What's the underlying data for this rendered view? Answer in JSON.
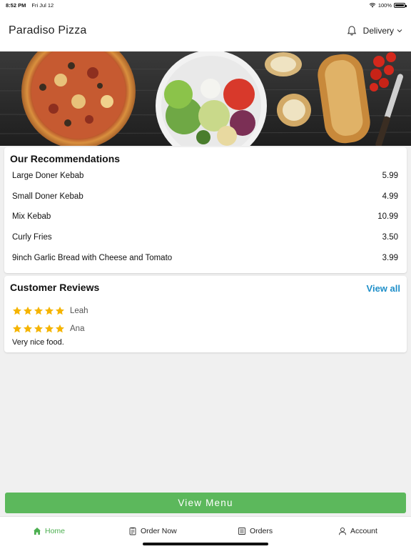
{
  "status_bar": {
    "time": "8:52 PM",
    "date": "Fri Jul 12",
    "battery": "100%",
    "wifi_icon": "wifi-icon",
    "battery_icon": "battery-icon"
  },
  "header": {
    "title": "Paradiso Pizza",
    "notification_icon": "bell-icon",
    "delivery_label": "Delivery",
    "dropdown_icon": "chevron-down-icon"
  },
  "banner": {
    "content": "food-banner-image"
  },
  "recommendations": {
    "heading": "Our Recommendations",
    "items": [
      {
        "name": "Large Doner Kebab",
        "price": "5.99"
      },
      {
        "name": "Small Doner Kebab",
        "price": "4.99"
      },
      {
        "name": "Mix Kebab",
        "price": "10.99"
      },
      {
        "name": "Curly Fries",
        "price": "3.50"
      },
      {
        "name": "9inch Garlic Bread with Cheese and Tomato",
        "price": "3.99"
      }
    ]
  },
  "reviews": {
    "heading": "Customer Reviews",
    "view_all": "View all",
    "items": [
      {
        "name": "Leah",
        "rating": 5,
        "text": ""
      },
      {
        "name": "Ana",
        "rating": 5,
        "text": "Very nice food."
      }
    ]
  },
  "view_menu_label": "View Menu",
  "tabs": [
    {
      "label": "Home",
      "icon": "home-icon",
      "active": true
    },
    {
      "label": "Order Now",
      "icon": "clipboard-icon",
      "active": false
    },
    {
      "label": "Orders",
      "icon": "receipt-icon",
      "active": false
    },
    {
      "label": "Account",
      "icon": "user-icon",
      "active": false
    }
  ],
  "colors": {
    "accent_green": "#5cb85c",
    "tab_active": "#4caf50",
    "link_blue": "#1f8fc9",
    "star": "#f5b400"
  }
}
